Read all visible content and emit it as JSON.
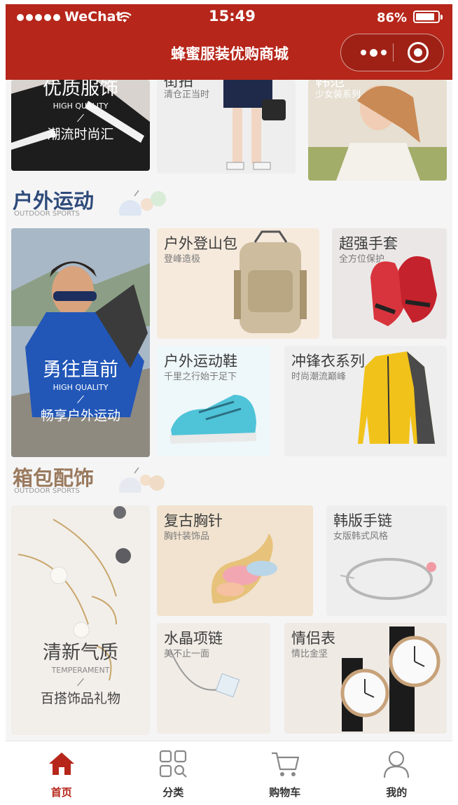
{
  "status_bar": {
    "carrier": "WeChat",
    "time": "15:49",
    "battery_text": "86%",
    "battery_level": 0.86
  },
  "nav": {
    "title": "蜂蜜服装优购商城"
  },
  "top_row": {
    "hero": {
      "title": "优质服饰",
      "subtitle_en": "HIGH QUALITY",
      "caption": "潮流时尚汇"
    },
    "middle": {
      "title": "街拍",
      "subtitle": "清仓正当时"
    },
    "right": {
      "title": "韩范",
      "subtitle": "少女装系列"
    }
  },
  "outdoor": {
    "title": "户外运动",
    "subtitle_en": "OUTDOOR SPORTS",
    "hero": {
      "title": "勇往直前",
      "subtitle_en": "HIGH QUALITY",
      "caption": "畅享户外运动"
    },
    "tiles": [
      {
        "title": "户外登山包",
        "subtitle": "登峰造极"
      },
      {
        "title": "超强手套",
        "subtitle": "全方位保护"
      },
      {
        "title": "户外运动鞋",
        "subtitle": "千里之行始于足下"
      },
      {
        "title": "冲锋衣系列",
        "subtitle": "时尚潮流巅峰"
      }
    ]
  },
  "bags": {
    "title": "箱包配饰",
    "subtitle_en": "OUTDOOR SPORTS",
    "hero": {
      "title": "清新气质",
      "subtitle_en": "TEMPERAMENT",
      "caption": "百搭饰品礼物"
    },
    "tiles": [
      {
        "title": "复古胸针",
        "subtitle": "胸针装饰品"
      },
      {
        "title": "韩版手链",
        "subtitle": "女版韩式风格"
      },
      {
        "title": "水晶项链",
        "subtitle": "美不止一面"
      },
      {
        "title": "情侣表",
        "subtitle": "情比金坚"
      }
    ]
  },
  "tabbar": {
    "items": [
      {
        "label": "首页",
        "icon": "home-icon",
        "active": true
      },
      {
        "label": "分类",
        "icon": "category-icon",
        "active": false
      },
      {
        "label": "购物车",
        "icon": "cart-icon",
        "active": false
      },
      {
        "label": "我的",
        "icon": "user-icon",
        "active": false
      }
    ]
  },
  "colors": {
    "brand_red": "#b6261a",
    "outdoor_blue": "#2e4a7a",
    "bags_brown": "#9a7a5e"
  }
}
